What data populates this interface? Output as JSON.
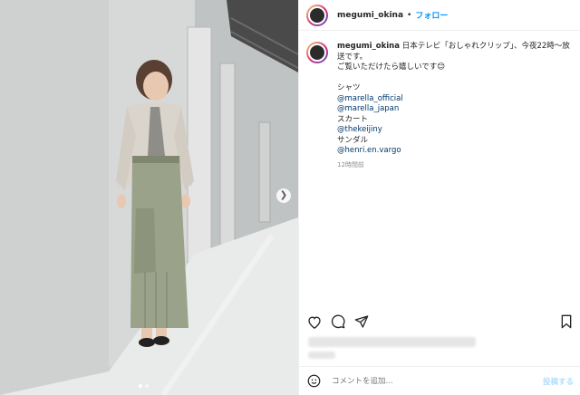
{
  "post": {
    "username": "megumi_okina",
    "follow_label": "フォロー",
    "caption_line1": "日本テレビ「おしゃれクリップ」、今夜22時〜放送です。",
    "caption_line2": "ご覧いただけたら嬉しいです😊",
    "items": [
      {
        "kind": "plain",
        "text": "シャツ"
      },
      {
        "kind": "mention",
        "text": "@marella_official"
      },
      {
        "kind": "mention",
        "text": "@marella_japan"
      },
      {
        "kind": "plain",
        "text": "スカート"
      },
      {
        "kind": "mention",
        "text": "@thekeijiny"
      },
      {
        "kind": "plain",
        "text": "サンダル"
      },
      {
        "kind": "mention",
        "text": "@henri.en.vargo"
      }
    ],
    "time": "12時間前"
  },
  "carousel": {
    "slide_count": 2,
    "active_index": 0
  },
  "icons": {
    "like": "heart-icon",
    "comment": "comment-icon",
    "share": "send-icon",
    "save": "bookmark-icon",
    "emoji": "smiley-icon",
    "next": "chevron-right-icon"
  },
  "comment_box": {
    "placeholder": "コメントを追加...",
    "post_label": "投稿する"
  },
  "colors": {
    "link": "#00376b",
    "follow": "#0095f6",
    "post_disabled": "#b2dffc"
  }
}
